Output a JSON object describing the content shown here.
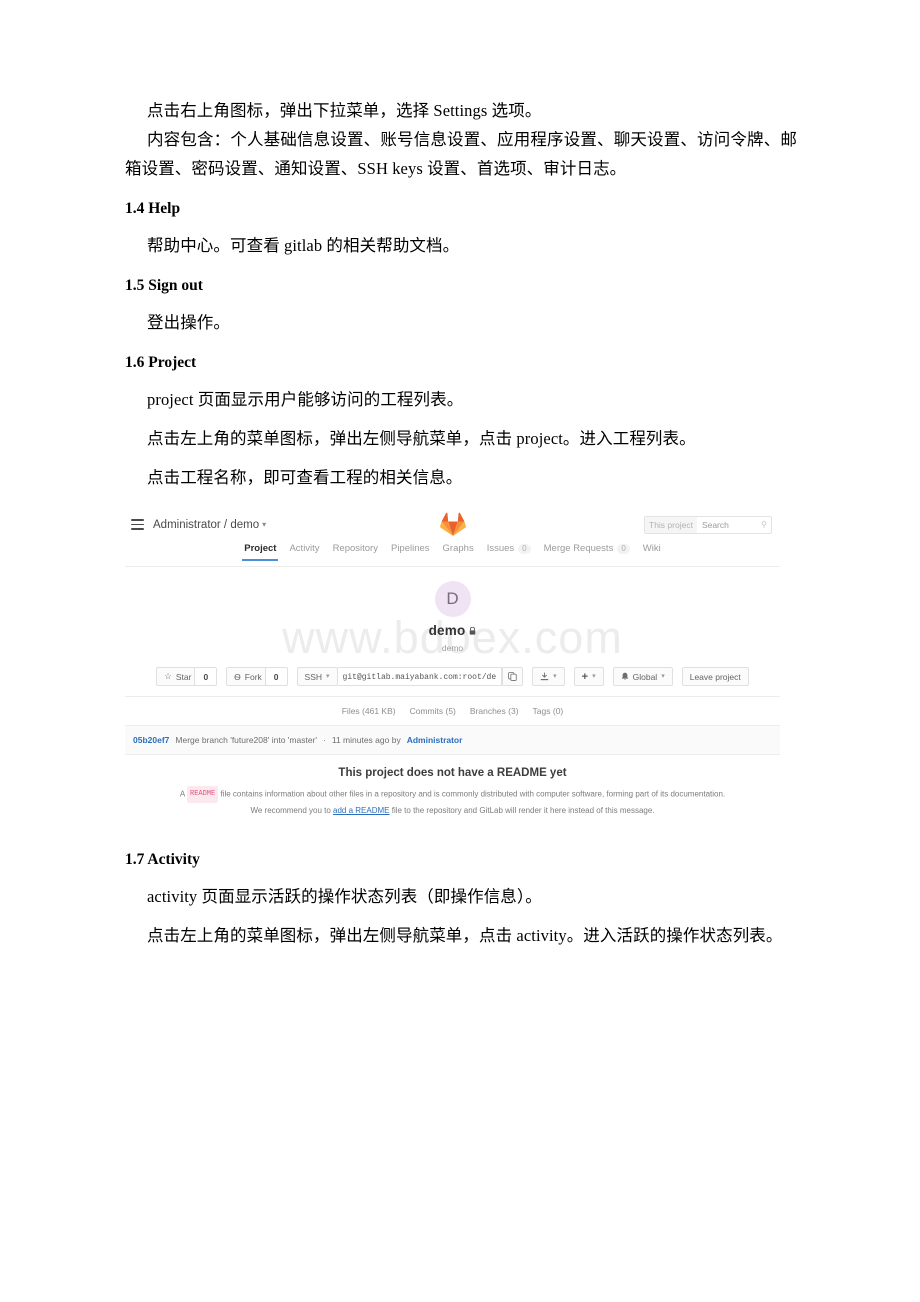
{
  "document": {
    "paragraphs_top": [
      "点击右上角图标，弹出下拉菜单，选择 Settings 选项。",
      "内容包含：个人基础信息设置、账号信息设置、应用程序设置、聊天设置、访问令牌、邮箱设置、密码设置、通知设置、SSH keys 设置、首选项、审计日志。"
    ],
    "section_help": {
      "heading": "1.4 Help",
      "body": "帮助中心。可查看 gitlab 的相关帮助文档。"
    },
    "section_signout": {
      "heading": "1.5 Sign out",
      "body": "登出操作。"
    },
    "section_project": {
      "heading": "1.6 Project",
      "body1": "project 页面显示用户能够访问的工程列表。",
      "body2": "点击左上角的菜单图标，弹出左侧导航菜单，点击 project。进入工程列表。",
      "body3": "点击工程名称，即可查看工程的相关信息。"
    },
    "section_activity": {
      "heading": "1.7 Activity",
      "body1": "activity 页面显示活跃的操作状态列表（即操作信息）。",
      "body2": "点击左上角的菜单图标，弹出左侧导航菜单，点击 activity。进入活跃的操作状态列表。"
    }
  },
  "screenshot": {
    "watermark": "www.bdoex.com",
    "topbar": {
      "breadcrumb": "Administrator / demo",
      "menu_icon": "hamburger-icon",
      "logo_icon": "gitlab-logo",
      "search": {
        "scope": "This project",
        "placeholder": "Search",
        "icon": "search-icon"
      }
    },
    "tabs": [
      {
        "label": "Project",
        "active": true,
        "badge": null
      },
      {
        "label": "Activity",
        "active": false,
        "badge": null
      },
      {
        "label": "Repository",
        "active": false,
        "badge": null
      },
      {
        "label": "Pipelines",
        "active": false,
        "badge": null
      },
      {
        "label": "Graphs",
        "active": false,
        "badge": null
      },
      {
        "label": "Issues",
        "active": false,
        "badge": "0"
      },
      {
        "label": "Merge Requests",
        "active": false,
        "badge": "0"
      },
      {
        "label": "Wiki",
        "active": false,
        "badge": null
      }
    ],
    "hero": {
      "avatar_letter": "D",
      "avatar_color": "#f0e3f3",
      "project_name": "demo",
      "visibility_icon": "lock-icon",
      "project_subtitle": "demo"
    },
    "actions": {
      "star_label": "Star",
      "star_count": "0",
      "star_icon": "star-icon",
      "fork_label": "Fork",
      "fork_count": "0",
      "fork_icon": "fork-icon",
      "protocol_label": "SSH",
      "clone_url": "git@gitlab.maiyabank.com:root/de",
      "copy_icon": "copy-icon",
      "download_icon": "download-icon",
      "plus_icon": "plus-icon",
      "notification_icon": "bell-icon",
      "notification_label": "Global",
      "leave_label": "Leave project"
    },
    "stats": [
      "Files (461 KB)",
      "Commits (5)",
      "Branches (3)",
      "Tags (0)"
    ],
    "commit": {
      "sha": "05b20ef7",
      "message": "Merge branch 'future208' into 'master'",
      "separator": "·",
      "time": "11 minutes ago by",
      "author": "Administrator"
    },
    "readme": {
      "title": "This project does not have a README yet",
      "line1_prefix": "A",
      "badge": "README",
      "line1_suffix": "file contains information about other files in a repository and is commonly distributed with computer software, forming part of its documentation.",
      "line2_prefix": "We recommend you to",
      "line2_link": "add a README",
      "line2_suffix": "file to the repository and GitLab will render it here instead of this message."
    },
    "accent_color": "#4a90d9",
    "link_color": "#2a6ebb"
  }
}
